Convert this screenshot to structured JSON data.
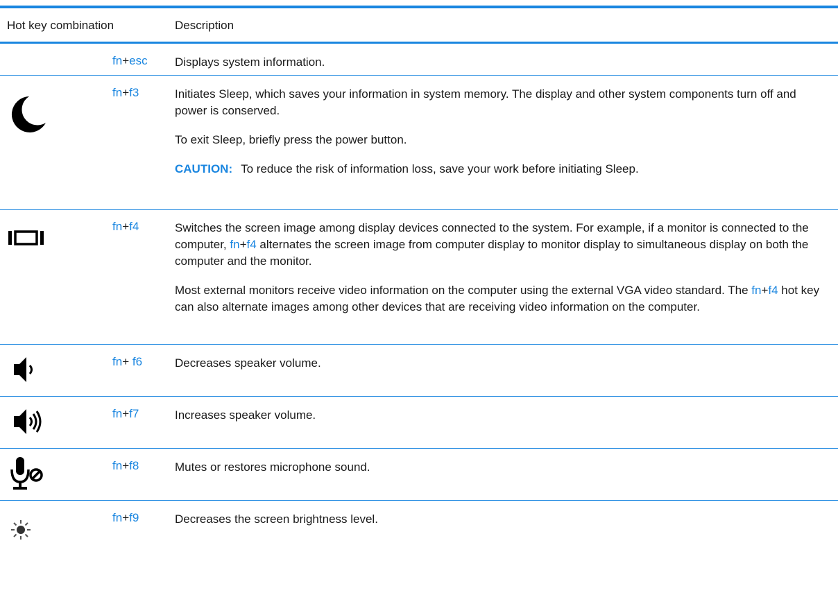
{
  "header": {
    "combo_label": "Hot key combination",
    "desc_label": "Description"
  },
  "rows": [
    {
      "icon": "none",
      "fn": "fn",
      "plus": "+",
      "key": "esc",
      "desc": "Displays system information."
    },
    {
      "icon": "moon-icon",
      "fn": "fn",
      "plus": "+",
      "key": "f3",
      "p1": "Initiates Sleep, which saves your information in system memory. The display and other system components turn off and power is conserved.",
      "p2": "To exit Sleep, briefly press the power button.",
      "caution_label": "CAUTION:",
      "caution_text": "To reduce the risk of information loss, save your work before initiating Sleep."
    },
    {
      "icon": "display-switch-icon",
      "fn": "fn",
      "plus": "+",
      "key": "f4",
      "p1_a": "Switches the screen image among display devices connected to the system. For example, if a monitor is connected to the computer, ",
      "p1_fn": "fn",
      "p1_plus": "+",
      "p1_key": "f4",
      "p1_b": " alternates the screen image from computer display to monitor display to simultaneous display on both the computer and the monitor.",
      "p2_a": "Most external monitors receive video information on the computer using the external VGA video standard. The ",
      "p2_fn": "fn",
      "p2_plus": "+",
      "p2_key": "f4",
      "p2_b": " hot key can also alternate images among other devices that are receiving video information on the computer."
    },
    {
      "icon": "volume-down-icon",
      "fn": "fn",
      "plus": "+ ",
      "key": "f6",
      "desc": "Decreases speaker volume."
    },
    {
      "icon": "volume-up-icon",
      "fn": "fn",
      "plus": "+",
      "key": "f7",
      "desc": "Increases speaker volume."
    },
    {
      "icon": "mic-mute-icon",
      "fn": "fn",
      "plus": "+",
      "key": "f8",
      "desc": "Mutes or restores microphone sound."
    },
    {
      "icon": "brightness-down-icon",
      "fn": "fn",
      "plus": "+",
      "key": "f9",
      "desc": "Decreases the screen brightness level."
    }
  ],
  "colors": {
    "accent": "#1a86e0",
    "text": "#1a1a1a"
  }
}
